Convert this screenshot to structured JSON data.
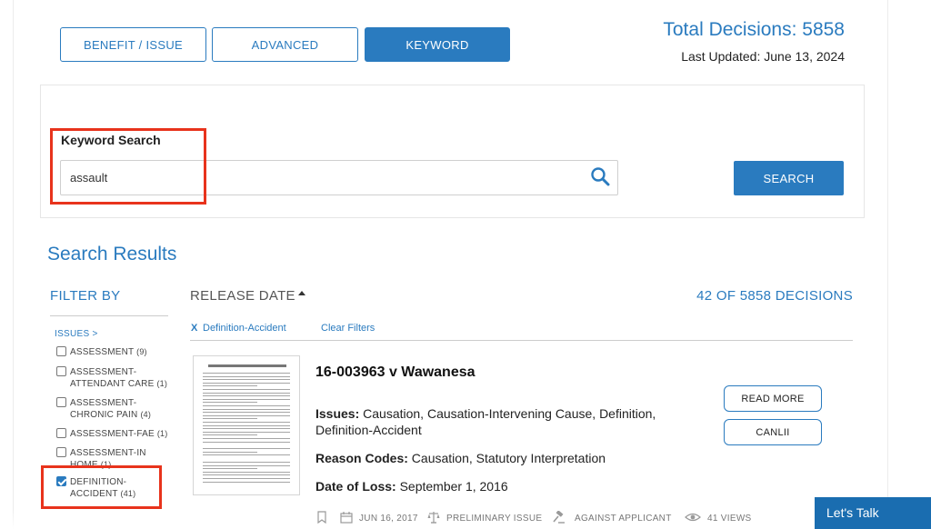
{
  "tabs": [
    {
      "label": "BENEFIT / ISSUE",
      "active": false
    },
    {
      "label": "ADVANCED",
      "active": false
    },
    {
      "label": "KEYWORD",
      "active": true
    }
  ],
  "summary": {
    "total_decisions": "Total Decisions: 5858",
    "last_updated": "Last Updated: June 13, 2024"
  },
  "search": {
    "label": "Keyword Search",
    "value": "assault",
    "button_label": "SEARCH",
    "icon": "search-icon"
  },
  "results": {
    "title": "Search Results",
    "sort_label": "RELEASE DATE",
    "count_label": "42  OF 5858 DECISIONS",
    "active_filter_remove": "X",
    "active_filter": "Definition-Accident",
    "clear_filters": "Clear Filters"
  },
  "filters": {
    "title": "FILTER BY",
    "issues_link": "ISSUES >",
    "items": [
      {
        "line1": "ASSESSMENT",
        "line2": "",
        "count": "(9)",
        "checked": false
      },
      {
        "line1": "ASSESSMENT-",
        "line2": "ATTENDANT CARE",
        "count": "(1)",
        "checked": false
      },
      {
        "line1": "ASSESSMENT-",
        "line2": "CHRONIC PAIN",
        "count": "(4)",
        "checked": false
      },
      {
        "line1": "ASSESSMENT-FAE",
        "line2": "",
        "count": "(1)",
        "checked": false
      },
      {
        "line1": "ASSESSMENT-IN",
        "line2": "HOME",
        "count": "(1)",
        "checked": false
      },
      {
        "line1": "DEFINITION-",
        "line2": "ACCIDENT",
        "count": "(41)",
        "checked": true
      }
    ]
  },
  "decision": {
    "title": "16-003963 v Wawanesa",
    "issues_label": "Issues:",
    "issues_value": " Causation, Causation-Intervening Cause, Definition,",
    "issues_value2": "Definition-Accident",
    "reason_label": "Reason Codes:",
    "reason_value": " Causation, Statutory Interpretation",
    "loss_label": "Date of Loss:",
    "loss_value": " September 1, 2016",
    "read_more": "READ MORE",
    "canlii": "CANLII",
    "meta_date": "JUN 16, 2017",
    "meta_issue": "PRELIMINARY ISSUE",
    "meta_against": "AGAINST APPLICANT",
    "meta_views": "41 VIEWS"
  },
  "chat": {
    "label": "Let's Talk"
  },
  "colors": {
    "accent": "#2a7bbf",
    "highlight": "#e8331c",
    "chat": "#1a6db0"
  }
}
